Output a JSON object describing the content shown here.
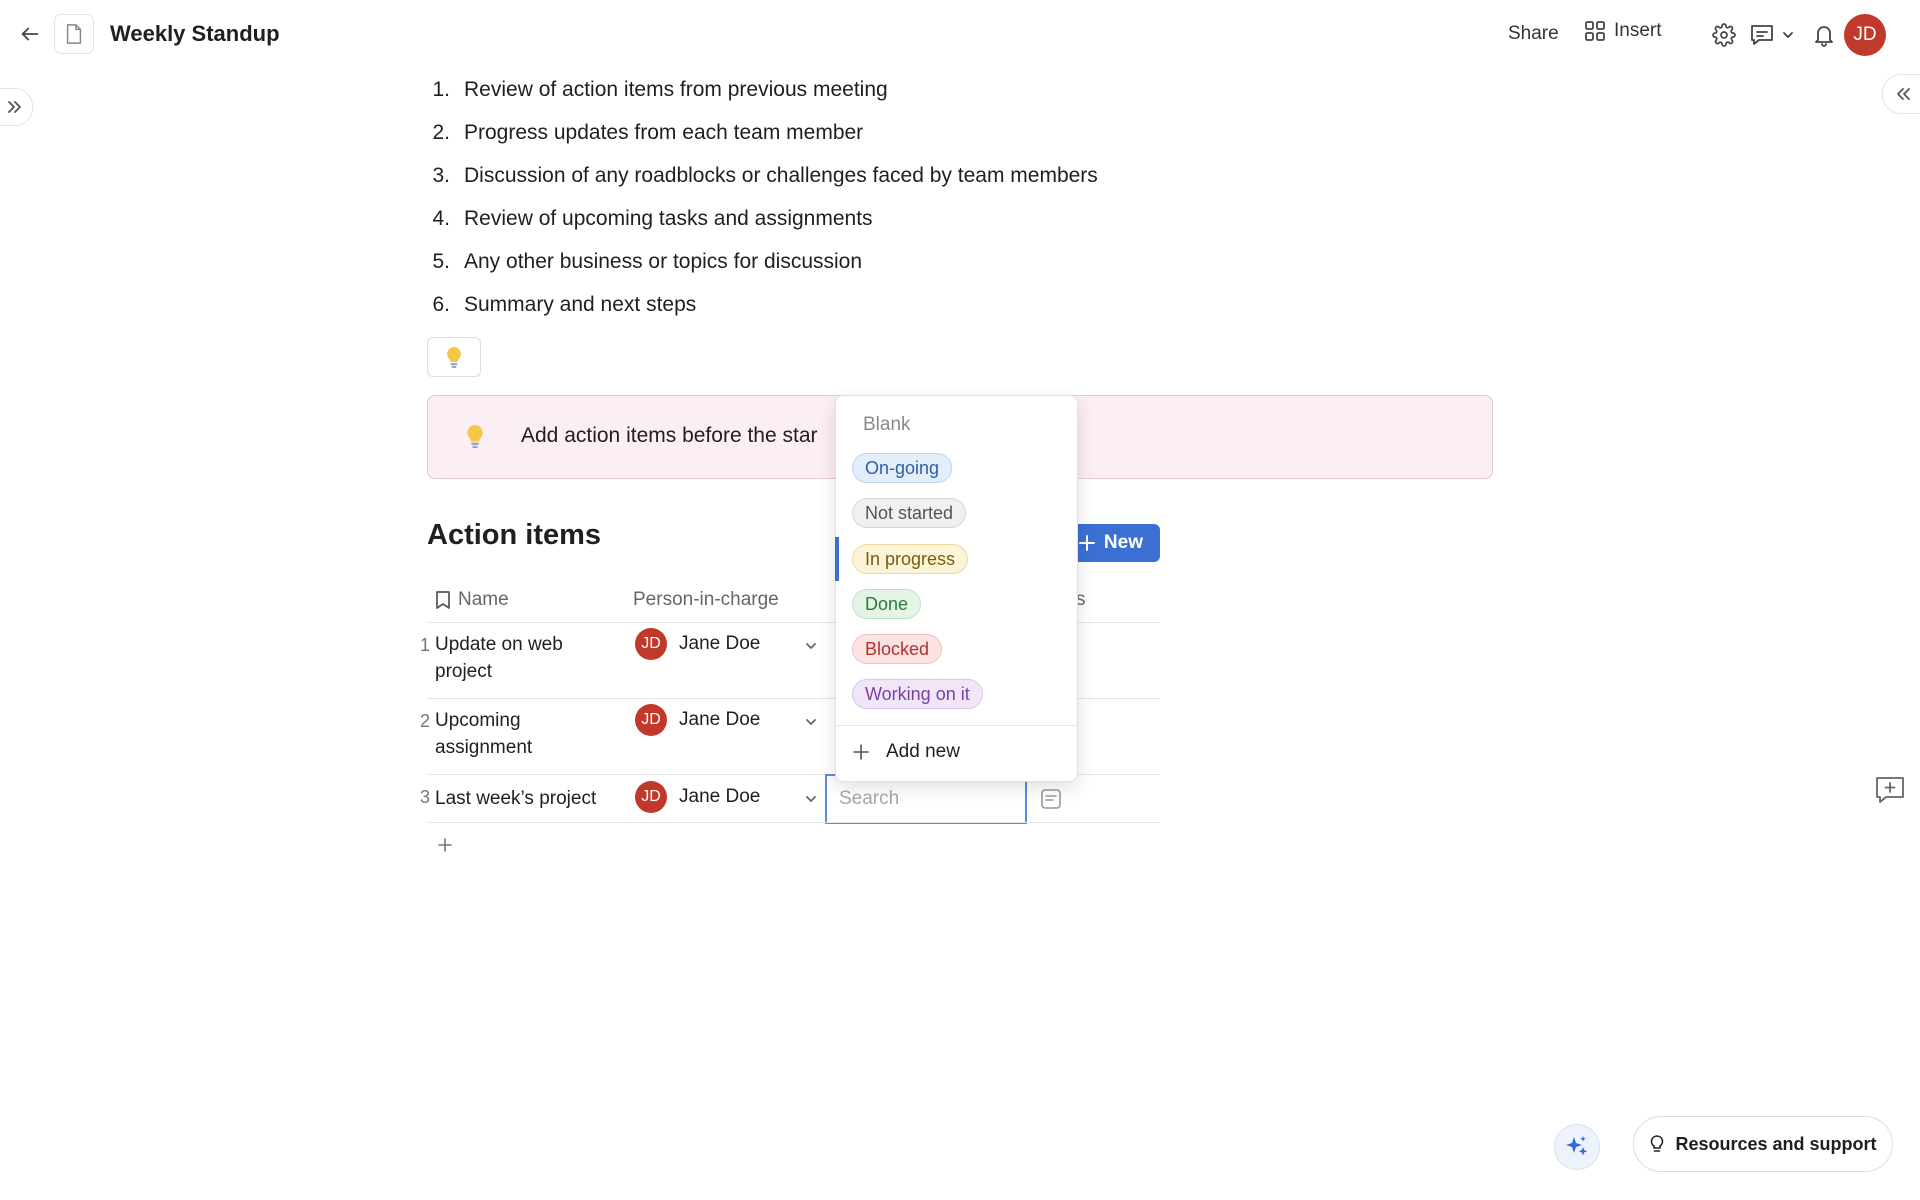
{
  "header": {
    "title": "Weekly Standup",
    "share_label": "Share",
    "insert_label": "Insert",
    "avatar_initials": "JD"
  },
  "agenda": {
    "items": [
      {
        "num": "1.",
        "text": "Review of action items from previous meeting"
      },
      {
        "num": "2.",
        "text": "Progress updates from each team member"
      },
      {
        "num": "3.",
        "text": "Discussion of any roadblocks or challenges faced by team members"
      },
      {
        "num": "4.",
        "text": "Review of upcoming tasks and assignments"
      },
      {
        "num": "5.",
        "text": "Any other business or topics for discussion"
      },
      {
        "num": "6.",
        "text": "Summary and next steps"
      }
    ]
  },
  "callout": {
    "text": "Add action items before the star"
  },
  "table": {
    "title": "Action items",
    "new_label": "New",
    "columns": {
      "name": "Name",
      "person": "Person-in-charge",
      "status_fragment": "s"
    },
    "search_placeholder": "Search",
    "rows": [
      {
        "num": "1",
        "name": "Update on web project",
        "person": "Jane Doe",
        "initials": "JD"
      },
      {
        "num": "2",
        "name": "Upcoming assignment",
        "person": "Jane Doe",
        "initials": "JD"
      },
      {
        "num": "3",
        "name": "Last week’s project",
        "person": "Jane Doe",
        "initials": "JD"
      }
    ]
  },
  "status_dropdown": {
    "blank_label": "Blank",
    "selected": "In progress",
    "options": [
      {
        "label": "On-going",
        "bg": "#e3eefb",
        "border": "#b9d2f1",
        "color": "#2f5fa8"
      },
      {
        "label": "Not started",
        "bg": "#f0f0f0",
        "border": "#d6d6d6",
        "color": "#555555"
      },
      {
        "label": "In progress",
        "bg": "#fcf4d6",
        "border": "#ecdba0",
        "color": "#7a5c10"
      },
      {
        "label": "Done",
        "bg": "#e4f4e6",
        "border": "#bfe2c4",
        "color": "#2e7a3a"
      },
      {
        "label": "Blocked",
        "bg": "#fbe3e3",
        "border": "#f0c0c0",
        "color": "#b3312f"
      },
      {
        "label": "Working on it",
        "bg": "#f1e6f8",
        "border": "#dcc4ee",
        "color": "#7b3fa8"
      }
    ],
    "add_new_label": "Add new"
  },
  "footer": {
    "resources_label": "Resources and support"
  },
  "colors": {
    "accent": "#3b6fd4",
    "avatar": "#c0392b",
    "callout_bg": "#fbeef4"
  }
}
